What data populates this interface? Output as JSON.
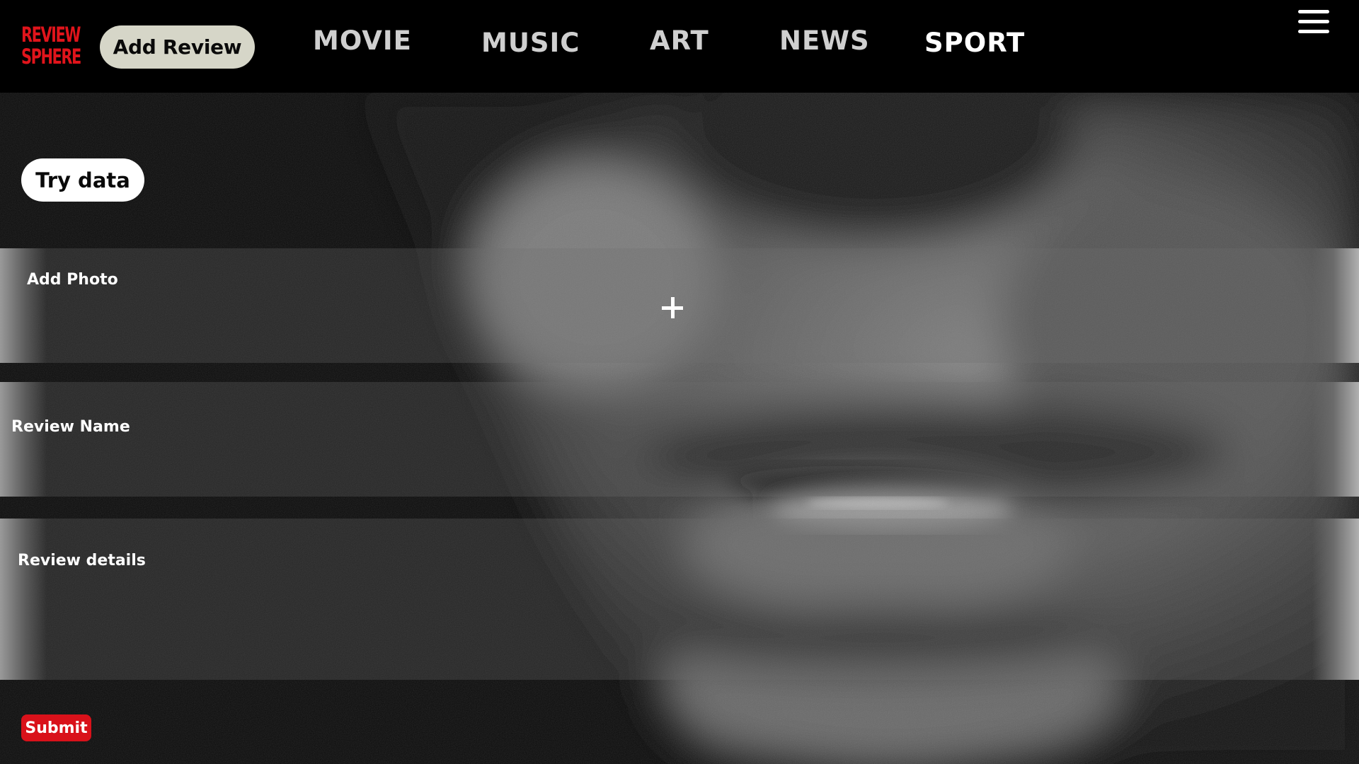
{
  "brand": {
    "logo_line1": "REVIEW",
    "logo_line2": "SPHERE",
    "logo_color": "#e0141b"
  },
  "header": {
    "add_review_label": "Add Review",
    "nav": [
      {
        "label": "MOVIE",
        "active": false
      },
      {
        "label": "MUSIC",
        "active": false
      },
      {
        "label": "ART",
        "active": false
      },
      {
        "label": "NEWS",
        "active": false
      },
      {
        "label": "SPORT",
        "active": true
      }
    ],
    "menu_icon": "hamburger-menu-icon"
  },
  "hero": {
    "description": "black-and-white close-up background photo",
    "tone": "grayscale"
  },
  "form": {
    "try_data_label": "Try data",
    "add_photo_label": "Add Photo",
    "add_photo_icon": "plus-icon",
    "review_name_label": "Review Name",
    "review_name_value": "",
    "review_details_label": "Review details",
    "review_details_value": "",
    "submit_label": "Submit",
    "submit_color": "#d9111a"
  }
}
